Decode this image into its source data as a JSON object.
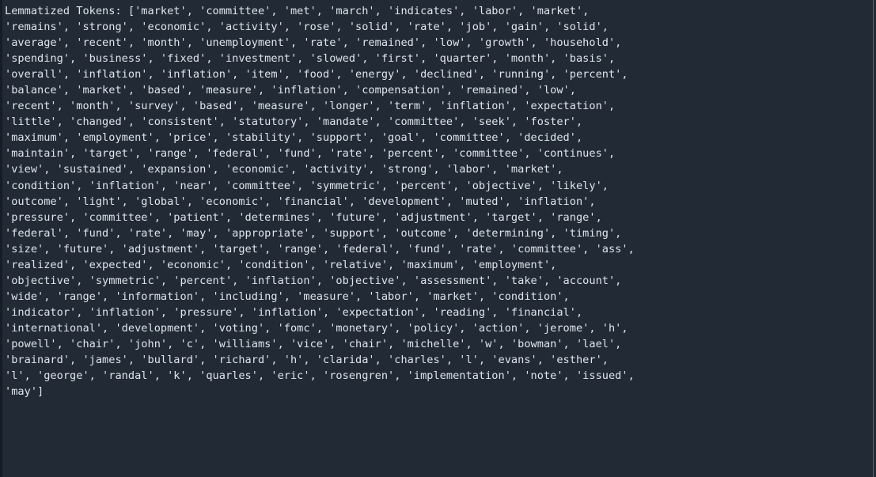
{
  "console": {
    "label": "Lemmatized Tokens:",
    "background_color": "#222b35",
    "text_color": "#dfe4ec",
    "separator_color": "#5a6572",
    "lines": [
      "Lemmatized Tokens: ['market', 'committee', 'met', 'march', 'indicates', 'labor', 'market',",
      "'remains', 'strong', 'economic', 'activity', 'rose', 'solid', 'rate', 'job', 'gain', 'solid',",
      "'average', 'recent', 'month', 'unemployment', 'rate', 'remained', 'low', 'growth', 'household',",
      "'spending', 'business', 'fixed', 'investment', 'slowed', 'first', 'quarter', 'month', 'basis',",
      "'overall', 'inflation', 'inflation', 'item', 'food', 'energy', 'declined', 'running', 'percent',",
      "'balance', 'market', 'based', 'measure', 'inflation', 'compensation', 'remained', 'low',",
      "'recent', 'month', 'survey', 'based', 'measure', 'longer', 'term', 'inflation', 'expectation',",
      "'little', 'changed', 'consistent', 'statutory', 'mandate', 'committee', 'seek', 'foster',",
      "'maximum', 'employment', 'price', 'stability', 'support', 'goal', 'committee', 'decided',",
      "'maintain', 'target', 'range', 'federal', 'fund', 'rate', 'percent', 'committee', 'continues',",
      "'view', 'sustained', 'expansion', 'economic', 'activity', 'strong', 'labor', 'market',",
      "'condition', 'inflation', 'near', 'committee', 'symmetric', 'percent', 'objective', 'likely',",
      "'outcome', 'light', 'global', 'economic', 'financial', 'development', 'muted', 'inflation',",
      "'pressure', 'committee', 'patient', 'determines', 'future', 'adjustment', 'target', 'range',",
      "'federal', 'fund', 'rate', 'may', 'appropriate', 'support', 'outcome', 'determining', 'timing',",
      "'size', 'future', 'adjustment', 'target', 'range', 'federal', 'fund', 'rate', 'committee', 'ass',",
      "'realized', 'expected', 'economic', 'condition', 'relative', 'maximum', 'employment',",
      "'objective', 'symmetric', 'percent', 'inflation', 'objective', 'assessment', 'take', 'account',",
      "'wide', 'range', 'information', 'including', 'measure', 'labor', 'market', 'condition',",
      "'indicator', 'inflation', 'pressure', 'inflation', 'expectation', 'reading', 'financial',",
      "'international', 'development', 'voting', 'fomc', 'monetary', 'policy', 'action', 'jerome', 'h',",
      "'powell', 'chair', 'john', 'c', 'williams', 'vice', 'chair', 'michelle', 'w', 'bowman', 'lael',",
      "'brainard', 'james', 'bullard', 'richard', 'h', 'clarida', 'charles', 'l', 'evans', 'esther',",
      "'l', 'george', 'randal', 'k', 'quarles', 'eric', 'rosengren', 'implementation', 'note', 'issued',",
      "'may']"
    ]
  }
}
